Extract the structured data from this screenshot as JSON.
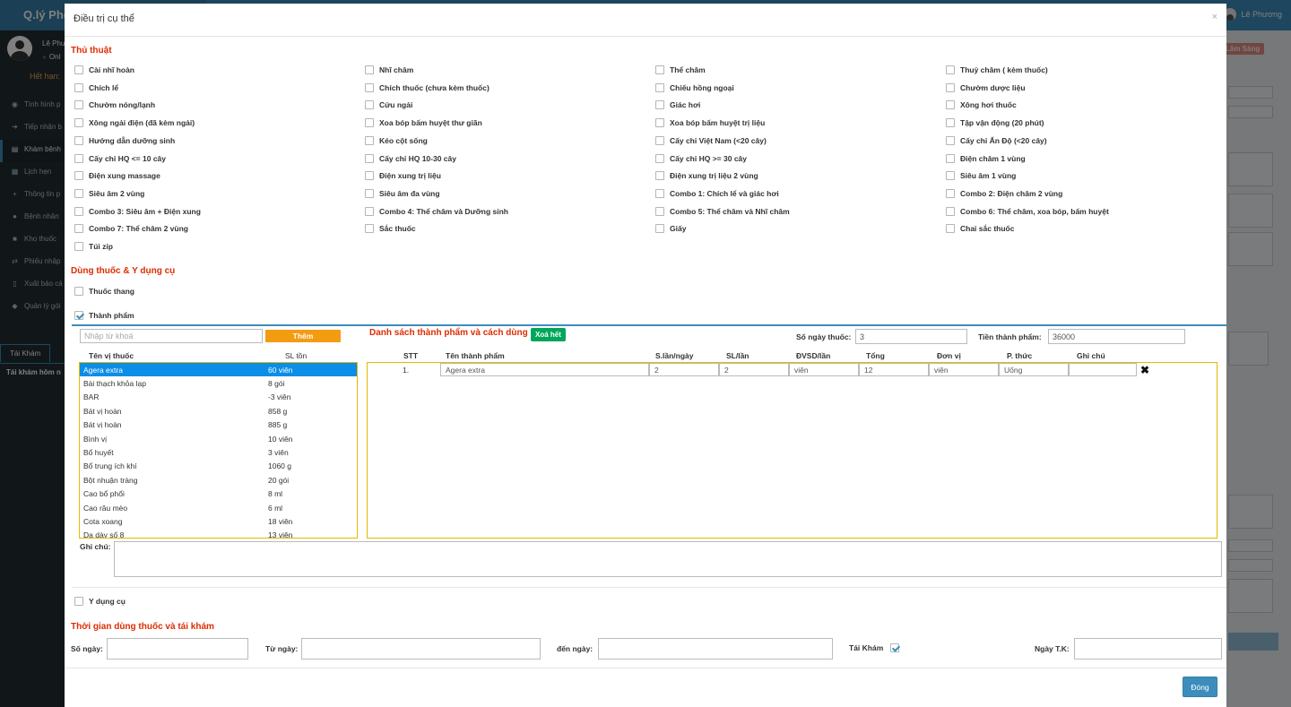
{
  "app": {
    "logo": "Q.lý Phò",
    "top_user": "Lê Phương",
    "sidebar_user": "Lê Phư",
    "sidebar_status": "Onl",
    "expiry_label": "Hết hạn:",
    "menu": [
      {
        "icon": "dashboard-icon",
        "glyph": "◉",
        "label": "Tình hình p"
      },
      {
        "icon": "sign-in-icon",
        "glyph": "➔",
        "label": "Tiếp nhận b"
      },
      {
        "icon": "clipboard-icon",
        "glyph": "▤",
        "label": "Khám bệnh"
      },
      {
        "icon": "calendar-icon",
        "glyph": "▦",
        "label": "Lịch hẹn"
      },
      {
        "icon": "plus-icon",
        "glyph": "+",
        "label": "Thông tin p"
      },
      {
        "icon": "user-icon",
        "glyph": "●",
        "label": "Bệnh nhân"
      },
      {
        "icon": "truck-icon",
        "glyph": "■",
        "label": "Kho thuốc"
      },
      {
        "icon": "exchange-icon",
        "glyph": "⇄",
        "label": "Phiếu nhập"
      },
      {
        "icon": "file-icon",
        "glyph": "▯",
        "label": "Xuất báo cá"
      },
      {
        "icon": "tag-icon",
        "glyph": "◆",
        "label": "Quản lý gói"
      }
    ],
    "sidebar_tab": "Tái Khám",
    "sidebar_tab_content": "Tái khám hôm n",
    "bg_badge": "Lâm Sàng"
  },
  "modal": {
    "title": "Điều trị cụ thể",
    "close_glyph": "×",
    "procedures_title": "Thủ thuật",
    "procedures": [
      "Cài nhĩ hoàn",
      "Nhĩ châm",
      "Thể châm",
      "Thuỷ châm ( kèm thuốc)",
      "Chích lể",
      "Chích thuốc (chưa kèm thuốc)",
      "Chiếu hồng ngoại",
      "Chườm dược liệu",
      "Chườm nóng/lạnh",
      "Cứu ngải",
      "Giác hơi",
      "Xông hơi thuốc",
      "Xông ngải điện (đã kèm ngải)",
      "Xoa bóp bấm huyệt thư giãn",
      "Xoa bóp bấm huyệt trị liệu",
      "Tập vận động (20 phút)",
      "Hướng dẫn dưỡng sinh",
      "Kéo cột sống",
      "Cấy chỉ Việt Nam (<20 cây)",
      "Cấy chỉ Ấn Độ (<20 cây)",
      "Cấy chỉ HQ <= 10 cây",
      "Cấy chỉ HQ 10-30 cây",
      "Cấy chỉ HQ >= 30 cây",
      "Điện châm 1 vùng",
      "Điện xung massage",
      "Điện xung trị liệu",
      "Điện xung trị liệu 2 vùng",
      "Siêu âm 1 vùng",
      "Siêu âm 2 vùng",
      "Siêu âm đa vùng",
      "Combo 1: Chích lể và giác hơi",
      "Combo 2: Điện châm 2 vùng",
      "Combo 3: Siêu âm + Điện xung",
      "Combo 4: Thể châm và Dưỡng sinh",
      "Combo 5: Thể châm và Nhĩ châm",
      "Combo 6: Thể châm, xoa bóp, bấm huyệt",
      "Combo 7: Thể châm 2 vùng",
      "Sắc thuốc",
      "Giấy",
      "Chai sắc thuốc",
      "Túi zip"
    ],
    "medicine_title": "Dùng thuốc & Y dụng cụ",
    "thuoc_thang": "Thuốc thang",
    "thanh_pham": "Thành phẩm",
    "search_placeholder": "Nhập từ khoá",
    "add_button": "Thêm",
    "list_title": "Danh sách thành phẩm và cách dùng",
    "clear_button": "Xoá hết",
    "days_label": "Số ngày thuốc:",
    "days_value": "3",
    "cost_label": "Tiền thành phẩm:",
    "cost_value": "36000",
    "med_headers": {
      "name": "Tên vị thuốc",
      "stock": "SL tồn"
    },
    "medicines": [
      {
        "name": "Agera extra",
        "stock": "60 viên"
      },
      {
        "name": "Bài thạch khỏa lạp",
        "stock": "8 gói"
      },
      {
        "name": "BAR",
        "stock": "-3 viên"
      },
      {
        "name": "Bát vị hoàn",
        "stock": "858 g"
      },
      {
        "name": "Bát vị hoàn",
        "stock": "885 g"
      },
      {
        "name": "Bình vị",
        "stock": "10 viên"
      },
      {
        "name": "Bổ huyết",
        "stock": "3 viên"
      },
      {
        "name": "Bổ trung ích khí",
        "stock": "1060 g"
      },
      {
        "name": "Bột nhuận tràng",
        "stock": "20 gói"
      },
      {
        "name": "Cao bổ phổi",
        "stock": "8 ml"
      },
      {
        "name": "Cao râu mèo",
        "stock": "6 ml"
      },
      {
        "name": "Cota xoang",
        "stock": "18 viên"
      },
      {
        "name": "Dạ dày số 8",
        "stock": "13 viên"
      }
    ],
    "presc_headers": {
      "stt": "STT",
      "name": "Tên thành phẩm",
      "times": "S.lần/ngày",
      "qty": "SL/lần",
      "unit_use": "ĐVSD/lần",
      "total": "Tổng",
      "unit": "Đơn vị",
      "method": "P. thức",
      "note": "Ghi chú"
    },
    "prescription": [
      {
        "stt": "1.",
        "name": "Agera extra",
        "times": "2",
        "qty": "2",
        "unit_use": "viên",
        "total": "12",
        "unit": "viên",
        "method": "Uống",
        "note": ""
      }
    ],
    "note_label": "Ghi chú:",
    "y_dung_cu": "Y dụng cụ",
    "time_title": "Thời gian dùng thuốc và tái khám",
    "so_ngay_label": "Số ngày:",
    "tu_ngay_label": "Từ ngày:",
    "den_ngay_label": "đến ngày:",
    "tai_kham_label": "Tái Khám",
    "ngay_tk_label": "Ngày T.K:",
    "close_button": "Đóng"
  }
}
